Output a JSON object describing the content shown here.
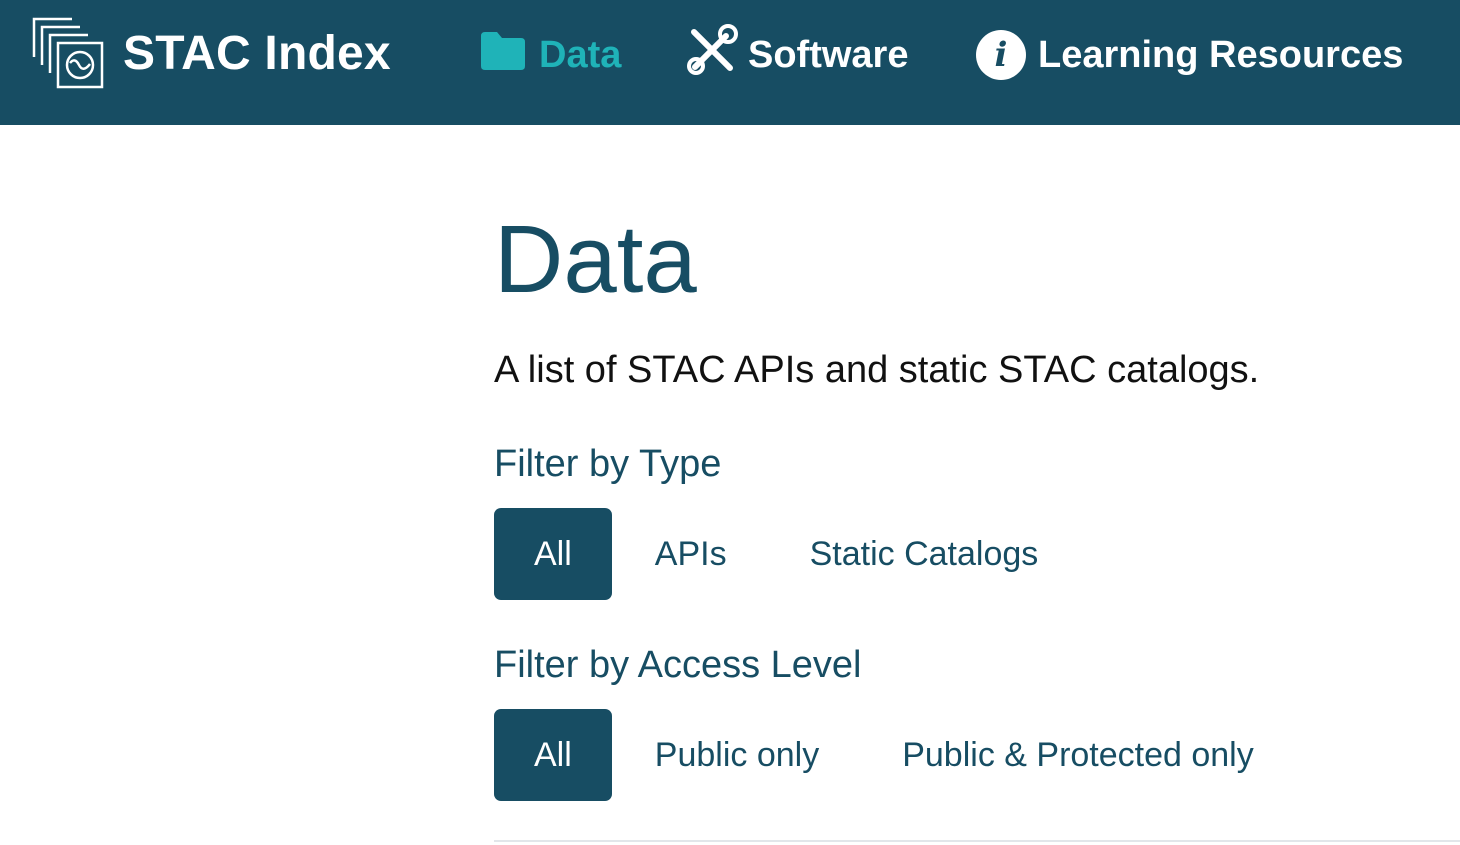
{
  "header": {
    "brand_name": "STAC Index",
    "nav": [
      {
        "label": "Data",
        "icon": "folder-icon",
        "active": true,
        "color": "#1fb3b8"
      },
      {
        "label": "Software",
        "icon": "tools-icon",
        "active": false
      },
      {
        "label": "Learning Resources",
        "icon": "info-icon",
        "active": false
      }
    ],
    "background": "#174d63"
  },
  "main": {
    "title": "Data",
    "intro": "A list of STAC APIs and static STAC catalogs.",
    "filter_type": {
      "heading": "Filter by Type",
      "options": [
        "All",
        "APIs",
        "Static Catalogs"
      ],
      "selected": "All"
    },
    "filter_access": {
      "heading": "Filter by Access Level",
      "options": [
        "All",
        "Public only",
        "Public & Protected only"
      ],
      "selected": "All"
    }
  },
  "colors": {
    "primary": "#174d63",
    "accent": "#1fb3b8",
    "text": "#111111"
  }
}
